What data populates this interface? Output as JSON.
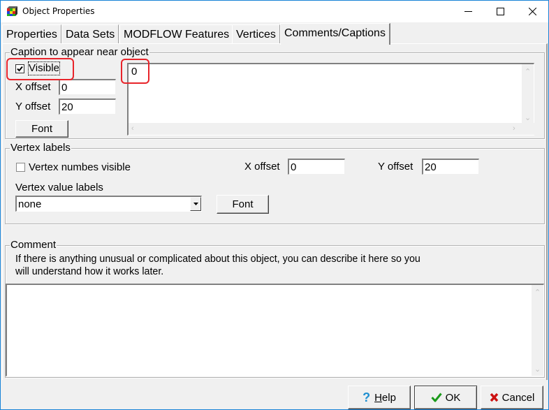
{
  "window": {
    "title": "Object Properties",
    "controls": {
      "minimize": "minimize-icon",
      "maximize": "maximize-icon",
      "close": "close-icon"
    }
  },
  "tabs": [
    {
      "label": "Properties",
      "active": false
    },
    {
      "label": "Data Sets",
      "active": false
    },
    {
      "label": "MODFLOW Features",
      "active": false
    },
    {
      "label": "Vertices",
      "active": false
    },
    {
      "label": "Comments/Captions",
      "active": true
    }
  ],
  "caption": {
    "group_label": "Caption to appear near object",
    "visible_label": "Visible",
    "visible_checked": true,
    "x_offset_label": "X offset",
    "x_offset_value": "0",
    "y_offset_label": "Y offset",
    "y_offset_value": "20",
    "font_button": "Font",
    "caption_text": "0"
  },
  "vertex_labels": {
    "group_label": "Vertex labels",
    "numbers_visible_label": "Vertex numbes visible",
    "numbers_visible_checked": false,
    "x_offset_label": "X offset",
    "x_offset_value": "0",
    "y_offset_label": "Y offset",
    "y_offset_value": "20",
    "value_labels_label": "Vertex value labels",
    "value_labels_selected": "none",
    "font_button": "Font"
  },
  "comment": {
    "group_label": "Comment",
    "description_line1": "If there is anything unusual or complicated about this object, you can describe it here so you",
    "description_line2": "will understand how it works later.",
    "text": ""
  },
  "buttons": {
    "help": "elp",
    "help_accel": "H",
    "ok": "OK",
    "cancel": "Cancel"
  },
  "colors": {
    "highlight": "#e8242a",
    "window_border": "#1883d7",
    "ok_check": "#1a9a1a",
    "cancel_x": "#cc1111",
    "help_q": "#1f8fd0"
  }
}
